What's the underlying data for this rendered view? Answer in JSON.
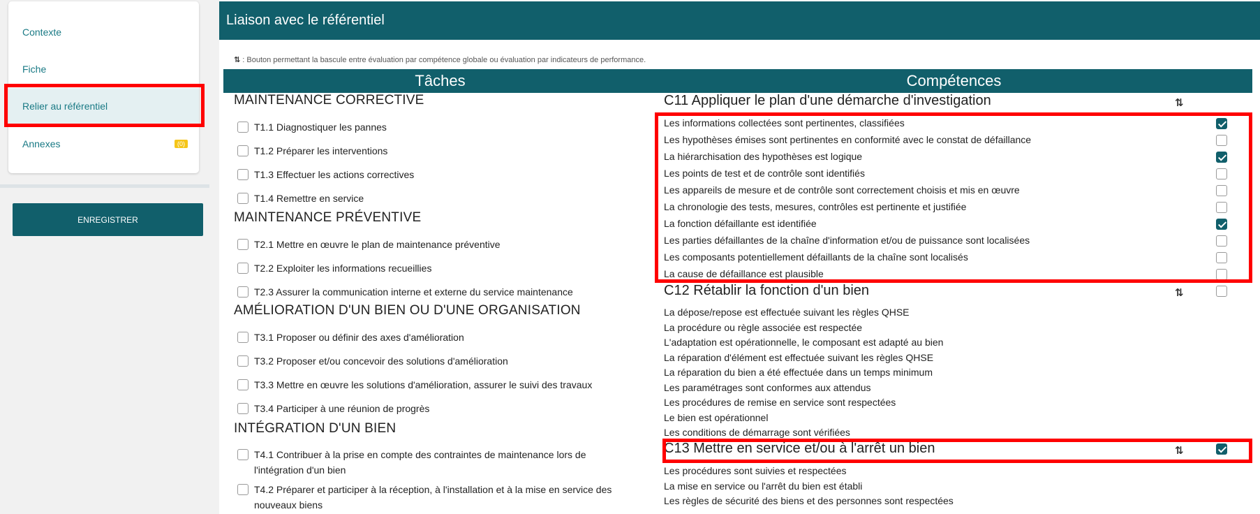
{
  "sidebar": {
    "items": [
      {
        "label": "Contexte"
      },
      {
        "label": "Fiche"
      },
      {
        "label": "Relier au référentiel"
      },
      {
        "label": "Annexes",
        "badge": "(0)"
      }
    ],
    "save_label": "ENREGISTRER"
  },
  "main": {
    "title": "Liaison avec le référentiel",
    "legend_icon": "⇅",
    "legend_text": " : Bouton permettant la bascule entre évaluation par compétence globale ou évaluation par indicateurs de performance.",
    "tasks_header": "Tâches",
    "competences_header": "Compétences",
    "swap_icon": "⇅"
  },
  "categories": [
    {
      "title": "MAINTENANCE CORRECTIVE",
      "tasks": [
        "T1.1 Diagnostiquer les pannes",
        "T1.2 Préparer les interventions",
        "T1.3 Effectuer les actions correctives",
        "T1.4 Remettre en service"
      ]
    },
    {
      "title": "MAINTENANCE PRÉVENTIVE",
      "tasks": [
        "T2.1 Mettre en œuvre le plan de maintenance préventive",
        "T2.2 Exploiter les informations recueillies",
        "T2.3 Assurer la communication interne et externe du service maintenance"
      ]
    },
    {
      "title": "AMÉLIORATION D'UN BIEN OU D'UNE ORGANISATION",
      "tasks": [
        "T3.1 Proposer ou définir des axes d'amélioration",
        "T3.2 Proposer et/ou concevoir des solutions d'amélioration",
        "T3.3 Mettre en œuvre les solutions d'amélioration, assurer le suivi des travaux",
        "T3.4 Participer à une réunion de progrès"
      ]
    },
    {
      "title": "INTÉGRATION D'UN BIEN",
      "tasks": [
        "T4.1 Contribuer à la prise en compte des contraintes de maintenance lors de l'intégration d'un bien",
        "T4.2 Préparer et participer à la réception, à l'installation et à la mise en service des nouveaux biens"
      ]
    }
  ],
  "competences": [
    {
      "title": "C11 Appliquer le plan d'une démarche d'investigation",
      "checked": false,
      "indicators": [
        {
          "text": "Les informations collectées sont pertinentes, classifiées",
          "checked": true
        },
        {
          "text": "Les hypothèses émises sont pertinentes en conformité avec le constat de défaillance",
          "checked": false
        },
        {
          "text": "La hiérarchisation des hypothèses est logique",
          "checked": true
        },
        {
          "text": "Les points de test et de contrôle sont identifiés",
          "checked": false
        },
        {
          "text": "Les appareils de mesure et de contrôle sont correctement choisis et mis en œuvre",
          "checked": false
        },
        {
          "text": "La chronologie des tests, mesures, contrôles est pertinente et justifiée",
          "checked": false
        },
        {
          "text": "La fonction défaillante est identifiée",
          "checked": true
        },
        {
          "text": "Les parties défaillantes de la chaîne d'information et/ou de puissance sont localisées",
          "checked": false
        },
        {
          "text": "Les composants potentiellement défaillants de la chaîne sont localisés",
          "checked": false
        },
        {
          "text": "La cause de défaillance est plausible",
          "checked": false
        }
      ]
    },
    {
      "title": "C12 Rétablir la fonction d'un bien",
      "checked": false,
      "indicators": [
        {
          "text": "La dépose/repose est effectuée suivant les règles QHSE"
        },
        {
          "text": "La procédure ou règle associée est respectée"
        },
        {
          "text": "L'adaptation est opérationnelle, le composant est adapté au bien"
        },
        {
          "text": "La réparation d'élément est effectuée suivant les règles QHSE"
        },
        {
          "text": "La réparation du bien a été effectuée dans un temps minimum"
        },
        {
          "text": "Les paramétrages sont conformes aux attendus"
        },
        {
          "text": "Les procédures de remise en service sont respectées"
        },
        {
          "text": "Le bien est opérationnel"
        },
        {
          "text": "Les conditions de démarrage sont vérifiées"
        }
      ]
    },
    {
      "title": "C13 Mettre en service et/ou à l'arrêt un bien",
      "checked": true,
      "indicators": [
        {
          "text": "Les procédures sont suivies et respectées"
        },
        {
          "text": "La mise en service ou l'arrêt du bien est établi"
        },
        {
          "text": "Les règles de sécurité des biens et des personnes sont respectées"
        }
      ]
    }
  ]
}
